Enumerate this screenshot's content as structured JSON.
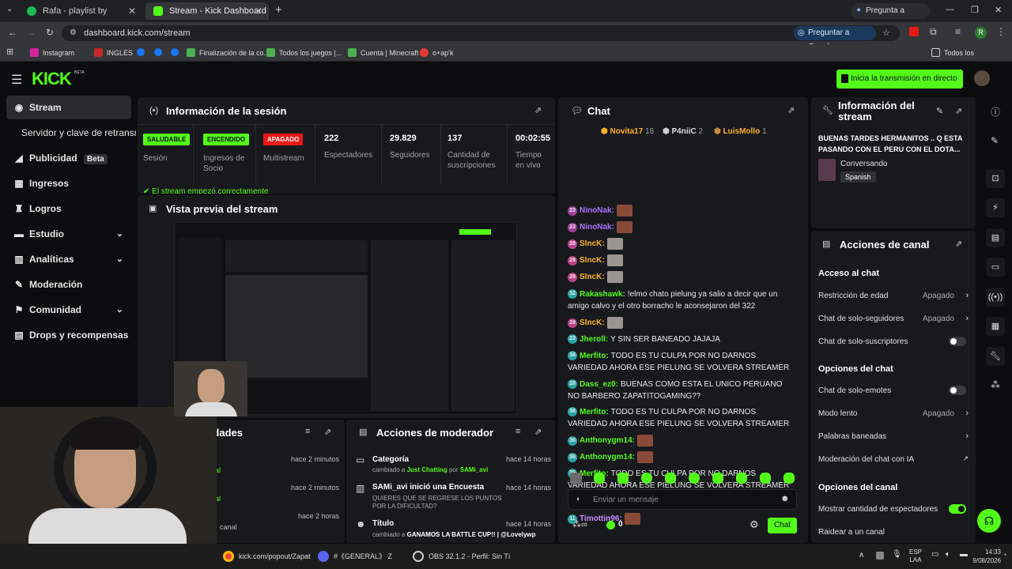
{
  "browser": {
    "tabs": [
      {
        "title": "Rafa - playlist by Rafael.xared |",
        "active": false
      },
      {
        "title": "Stream - Kick Dashboard",
        "active": true
      }
    ],
    "new_tab_symbol": "+",
    "gemini": "Pregunta a Gemini",
    "url": "dashboard.kick.com/stream",
    "ask_google": "Preguntar a Google",
    "profile_initial": "R",
    "bookmarks": [
      "Instagram",
      "INGLES",
      "Finalización de la co...",
      "Todos los juegos |...",
      "Cuenta | Minecraft",
      "o+ap'k"
    ],
    "all_bookmarks": "Todos los marcadores"
  },
  "header": {
    "logo": "KICK",
    "logo_sup": "BETA",
    "go_live_button": "Inicia la transmisión en directo"
  },
  "sidebar": {
    "items": [
      {
        "label": "Stream",
        "icon": "broadcast-icon"
      },
      {
        "label": "Servidor y clave de retransmisión",
        "icon": ""
      },
      {
        "label": "Publicidad",
        "icon": "megaphone-icon",
        "tag": "Beta"
      },
      {
        "label": "Ingresos",
        "icon": "money-icon"
      },
      {
        "label": "Logros",
        "icon": "trophy-icon"
      },
      {
        "label": "Estudio",
        "icon": "studio-icon",
        "chevron": true
      },
      {
        "label": "Analíticas",
        "icon": "analytics-icon",
        "chevron": true
      },
      {
        "label": "Moderación",
        "icon": "wrench-icon"
      },
      {
        "label": "Comunidad",
        "icon": "community-icon",
        "chevron": true
      },
      {
        "label": "Drops y recompensas",
        "icon": "gift-icon"
      }
    ]
  },
  "session": {
    "title": "Información de la sesión",
    "stats": [
      {
        "badge": "SALUDABLE",
        "label": "Sesión"
      },
      {
        "badge": "ENCENDIDO",
        "label": "Ingresos de Socio"
      },
      {
        "badge": "APAGADO",
        "label": "Multistream"
      },
      {
        "value": "222",
        "label": "Espectadores"
      },
      {
        "value": "29.829",
        "label": "Seguidores"
      },
      {
        "value": "137",
        "label": "Cantidad de suscripciones"
      },
      {
        "value": "00:02:55",
        "label": "Tiempo en vivo"
      }
    ],
    "status_msg": "El stream empezó correctamente"
  },
  "preview": {
    "title": "Vista previa del stream"
  },
  "activity": {
    "title": "Actividades",
    "items": [
      {
        "time": "hace 2 minutos",
        "text": "al"
      },
      {
        "time": "hace 2 minutos",
        "text": "al"
      },
      {
        "time": "hace 2 horas",
        "text": "canal"
      }
    ]
  },
  "mod_actions": {
    "title": "Acciones de moderador",
    "items": [
      {
        "title": "Categoría",
        "time": "hace 14 horas",
        "pre": "cambiado a",
        "hl1": "Just Chatting",
        "mid": "por",
        "hl2": "SAMi_avi"
      },
      {
        "title": "SAMi_avi inició una Encuesta",
        "time": "hace 14 horas",
        "detail": "QUIERES QUE SE REGRESE LOS PUNTOS POR LA DIFICULTAD?"
      },
      {
        "title": "Título",
        "time": "hace 14 horas",
        "pre": "cambiado a",
        "hl1": "GANAMOS LA BATTLE CUP!! | @Lovelywp",
        "mid": "",
        "hl2": ""
      }
    ]
  },
  "chat": {
    "title": "Chat",
    "top_gifters": [
      {
        "name": "Novita17",
        "count": "18"
      },
      {
        "name": "P4niiC",
        "count": "2"
      },
      {
        "name": "LuisMollo",
        "count": "1"
      }
    ],
    "messages": [
      {
        "level": "23",
        "user": "NinoNak:",
        "text": "",
        "emote": true,
        "color": "#a970ff"
      },
      {
        "level": "23",
        "user": "NinoNak:",
        "text": "",
        "emote": true,
        "color": "#a970ff"
      },
      {
        "level": "28",
        "user": "SIncK:",
        "text": "",
        "emote": true,
        "color": "#ffb020"
      },
      {
        "level": "28",
        "user": "SIncK:",
        "text": "",
        "emote": true,
        "color": "#ffb020"
      },
      {
        "level": "28",
        "user": "SIncK:",
        "text": "",
        "emote": true,
        "color": "#ffb020"
      },
      {
        "level": "32",
        "user": "Rakashawk:",
        "text": "!elmo chato pielung ya salio a decir que un amigo calvo y el otro borracho le aconsejaron del 322",
        "emote": false,
        "color": "#53fc18"
      },
      {
        "level": "28",
        "user": "SIncK:",
        "text": "",
        "emote": true,
        "color": "#ffb020"
      },
      {
        "level": "23",
        "user": "Jheroll:",
        "text": "Y SIN SER BANEADO JAJAJA",
        "emote": false,
        "color": "#53fc18"
      },
      {
        "level": "36",
        "user": "Merfito:",
        "text": "TODO ES TU CULPA POR NO DARNOS VARIEDAD AHORA ESE PIELUNG SE VOLVERA STREAMER",
        "emote": false,
        "color": "#53fc18"
      },
      {
        "level": "28",
        "user": "Dass_ez0:",
        "text": "BUENAS COMO ESTA EL UNICO PERUANO NO BARBERO ZAPATITOGAMING??",
        "emote": false,
        "color": "#53fc18"
      },
      {
        "level": "36",
        "user": "Merfito:",
        "text": "TODO ES TU CULPA POR NO DARNOS VARIEDAD AHORA ESE PIELUNG SE VOLVERA STREAMER",
        "emote": false,
        "color": "#53fc18"
      },
      {
        "level": "36",
        "user": "Anthonygm14:",
        "text": "",
        "emote": true,
        "color": "#53fc18"
      },
      {
        "level": "36",
        "user": "Anthonygm14:",
        "text": "",
        "emote": true,
        "color": "#53fc18"
      },
      {
        "level": "36",
        "user": "Merfito:",
        "text": "TODO ES TU CULPA POR NO DARNOS VARIEDAD AHORA ESE PIELUNG SE VOLVERA STREAMER",
        "emote": false,
        "color": "#53fc18"
      },
      {
        "level": "36",
        "user": "Anthonygm14:",
        "text": "",
        "emote": true,
        "color": "#53fc18"
      },
      {
        "level": "11",
        "user": "Timottin96:",
        "text": "",
        "emote": true,
        "color": "#c58cff"
      }
    ],
    "input_placeholder": "Enviar un mensaje",
    "points": "0",
    "send_button": "Chat"
  },
  "stream_info": {
    "title": "Información del stream",
    "stream_title": "BUENAS TARDES HERMANITOS .. Q ESTA PASANDO CON EL PERU CON EL DOTA...",
    "category": "Conversando",
    "language": "Spanish"
  },
  "channel_actions": {
    "title": "Acciones de canal",
    "sections": [
      {
        "heading": "Acceso al chat",
        "rows": [
          {
            "label": "Restricción de edad",
            "value": "Apagado",
            "kind": "arrow"
          },
          {
            "label": "Chat de solo-seguidores",
            "value": "Apagado",
            "kind": "arrow"
          },
          {
            "label": "Chat de solo-suscriptores",
            "value": "",
            "kind": "toggle-off"
          }
        ]
      },
      {
        "heading": "Opciones del chat",
        "rows": [
          {
            "label": "Chat de solo-emotes",
            "value": "",
            "kind": "toggle-off"
          },
          {
            "label": "Modo lento",
            "value": "Apagado",
            "kind": "arrow"
          },
          {
            "label": "Palabras baneadas",
            "value": "",
            "kind": "arrow"
          },
          {
            "label": "Moderación del chat con IA",
            "value": "",
            "kind": "external"
          }
        ]
      },
      {
        "heading": "Opciones del canal",
        "rows": [
          {
            "label": "Mostrar cantidad de espectadores",
            "value": "",
            "kind": "toggle-on"
          },
          {
            "label": "Raidear a un canal",
            "value": "",
            "kind": "none"
          }
        ]
      }
    ]
  },
  "taskbar": {
    "items": [
      "kick.com/popout/Zapat",
      "#《GENERAL》 Z",
      "OBS 32.1.2 - Perfil: Sin Tí"
    ],
    "lang": "ESP",
    "region": "LAA",
    "time": "14:33",
    "date": "9/08/2026"
  },
  "colors": {
    "accent": "#53fc18",
    "bg": "#0b0c0e",
    "panel": "#18191c",
    "danger": "#e91916"
  }
}
